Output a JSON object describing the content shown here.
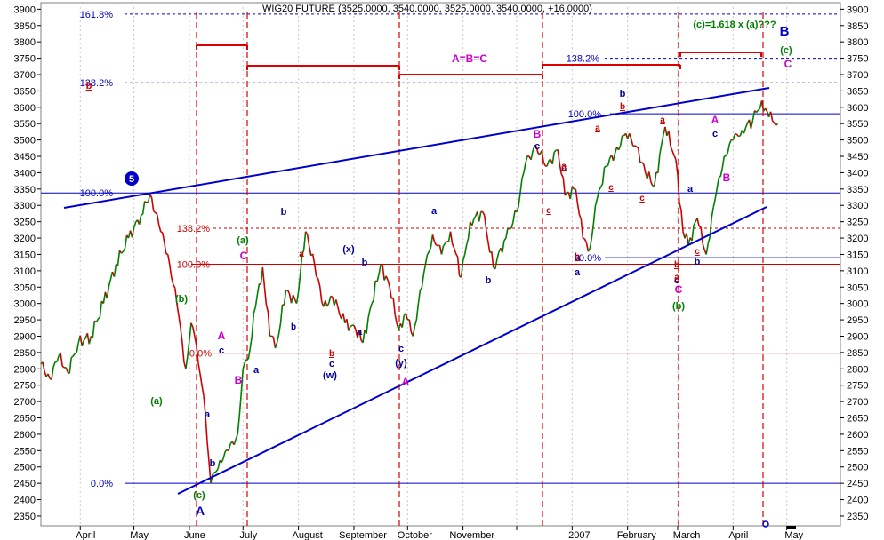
{
  "chart_data": {
    "type": "line",
    "title": "WIG20 FUTURE (3525.0000, 3540.0000, 3525.0000, 3540.0000, +16.0000)",
    "ylim": [
      2320,
      3920
    ],
    "y_ticks": [
      2350,
      2400,
      2450,
      2500,
      2550,
      2600,
      2650,
      2700,
      2750,
      2800,
      2850,
      2900,
      2950,
      3000,
      3050,
      3100,
      3150,
      3200,
      3250,
      3300,
      3350,
      3400,
      3450,
      3500,
      3550,
      3600,
      3650,
      3700,
      3750,
      3800,
      3850,
      3900
    ],
    "x_range": [
      "2006-03-10",
      "2007-05-31"
    ],
    "month_labels": [
      {
        "date": "2006-04-04",
        "label": "April"
      },
      {
        "date": "2006-05-04",
        "label": "May"
      },
      {
        "date": "2006-06-04",
        "label": "June"
      },
      {
        "date": "2006-07-04",
        "label": "July"
      },
      {
        "date": "2006-08-06",
        "label": "August"
      },
      {
        "date": "2006-09-06",
        "label": "September"
      },
      {
        "date": "2006-10-05",
        "label": "October"
      },
      {
        "date": "2006-11-06",
        "label": "November"
      },
      {
        "date": "2007-01-05",
        "label": "2007"
      },
      {
        "date": "2007-02-06",
        "label": "February"
      },
      {
        "date": "2007-03-06",
        "label": "March"
      },
      {
        "date": "2007-04-04",
        "label": "April"
      },
      {
        "date": "2007-05-05",
        "label": "May"
      }
    ],
    "grid_dates": [
      "2006-04-01",
      "2006-05-01",
      "2006-06-01",
      "2006-07-01",
      "2006-08-01",
      "2006-09-01",
      "2006-10-01",
      "2006-11-01",
      "2006-12-01",
      "2007-01-01",
      "2007-02-01",
      "2007-03-01",
      "2007-04-01",
      "2007-05-01"
    ],
    "series": [
      {
        "values": [
          [
            "2006-03-10",
            2815
          ],
          [
            "2006-03-15",
            2770
          ],
          [
            "2006-03-20",
            2840
          ],
          [
            "2006-03-25",
            2790
          ],
          [
            "2006-03-31",
            2880
          ],
          [
            "2006-04-07",
            2900
          ],
          [
            "2006-04-14",
            3000
          ],
          [
            "2006-04-21",
            3120
          ],
          [
            "2006-04-28",
            3200
          ],
          [
            "2006-05-05",
            3270
          ],
          [
            "2006-05-10",
            3335
          ],
          [
            "2006-05-15",
            3240
          ],
          [
            "2006-05-20",
            3150
          ],
          [
            "2006-05-25",
            3000
          ],
          [
            "2006-05-30",
            2800
          ],
          [
            "2006-06-02",
            2940
          ],
          [
            "2006-06-05",
            2870
          ],
          [
            "2006-06-08",
            2750
          ],
          [
            "2006-06-10",
            2660
          ],
          [
            "2006-06-13",
            2450
          ],
          [
            "2006-06-18",
            2520
          ],
          [
            "2006-06-23",
            2550
          ],
          [
            "2006-06-28",
            2600
          ],
          [
            "2006-07-01",
            2800
          ],
          [
            "2006-07-04",
            2830
          ],
          [
            "2006-07-08",
            2990
          ],
          [
            "2006-07-12",
            3110
          ],
          [
            "2006-07-16",
            2900
          ],
          [
            "2006-07-20",
            2880
          ],
          [
            "2006-07-25",
            3040
          ],
          [
            "2006-07-31",
            3000
          ],
          [
            "2006-08-05",
            3220
          ],
          [
            "2006-08-10",
            3120
          ],
          [
            "2006-08-15",
            2990
          ],
          [
            "2006-08-20",
            3020
          ],
          [
            "2006-08-27",
            2940
          ],
          [
            "2006-09-02",
            2920
          ],
          [
            "2006-09-06",
            2880
          ],
          [
            "2006-09-11",
            3000
          ],
          [
            "2006-09-16",
            3120
          ],
          [
            "2006-09-21",
            3050
          ],
          [
            "2006-09-26",
            2920
          ],
          [
            "2006-09-30",
            2970
          ],
          [
            "2006-10-04",
            2900
          ],
          [
            "2006-10-10",
            3090
          ],
          [
            "2006-10-15",
            3210
          ],
          [
            "2006-10-20",
            3150
          ],
          [
            "2006-10-25",
            3220
          ],
          [
            "2006-10-31",
            3080
          ],
          [
            "2006-11-05",
            3250
          ],
          [
            "2006-11-12",
            3280
          ],
          [
            "2006-11-18",
            3110
          ],
          [
            "2006-11-25",
            3200
          ],
          [
            "2006-12-01",
            3280
          ],
          [
            "2006-12-06",
            3430
          ],
          [
            "2006-12-12",
            3480
          ],
          [
            "2006-12-18",
            3420
          ],
          [
            "2006-12-24",
            3470
          ],
          [
            "2006-12-28",
            3330
          ],
          [
            "2007-01-03",
            3350
          ],
          [
            "2007-01-07",
            3200
          ],
          [
            "2007-01-11",
            3170
          ],
          [
            "2007-01-15",
            3320
          ],
          [
            "2007-01-20",
            3420
          ],
          [
            "2007-01-25",
            3460
          ],
          [
            "2007-01-31",
            3520
          ],
          [
            "2007-02-06",
            3480
          ],
          [
            "2007-02-11",
            3400
          ],
          [
            "2007-02-16",
            3360
          ],
          [
            "2007-02-22",
            3540
          ],
          [
            "2007-02-28",
            3440
          ],
          [
            "2007-03-04",
            3220
          ],
          [
            "2007-03-07",
            3180
          ],
          [
            "2007-03-12",
            3260
          ],
          [
            "2007-03-17",
            3150
          ],
          [
            "2007-03-22",
            3320
          ],
          [
            "2007-03-27",
            3450
          ],
          [
            "2007-04-01",
            3500
          ],
          [
            "2007-04-06",
            3530
          ],
          [
            "2007-04-12",
            3560
          ],
          [
            "2007-04-17",
            3620
          ],
          [
            "2007-04-21",
            3570
          ],
          [
            "2007-04-26",
            3550
          ]
        ]
      }
    ]
  },
  "h_lines": [
    {
      "value": 3885,
      "label": "161.8%",
      "color": "#0000cc"
    },
    {
      "value": 3675,
      "label": "138.2%",
      "color": "#0000cc"
    },
    {
      "value": 3338,
      "label": "100.0%",
      "color": "#0000cc"
    },
    {
      "value": 2450,
      "label": "0.0%",
      "color": "#0000cc"
    },
    {
      "value": 3230,
      "label": "138.2%",
      "color": "#cc0000"
    },
    {
      "value": 3120,
      "label": "100.0%",
      "color": "#cc0000"
    },
    {
      "value": 2848,
      "label": "0.0%",
      "color": "#cc0000"
    },
    {
      "value": 3750,
      "label": "138.2%",
      "color": "#0000cc"
    },
    {
      "value": 3580,
      "label": "100.0%",
      "color": "#0000cc"
    },
    {
      "value": 3140,
      "label": "0.0%",
      "color": "#0000cc"
    }
  ],
  "wave_labels": [
    {
      "text": "5",
      "color": "#0000cc"
    },
    {
      "text": "A",
      "color": "#0000cc"
    },
    {
      "text": "B",
      "color": "#0000cc"
    },
    {
      "text": "(a)",
      "color": "#008000"
    },
    {
      "text": "(b)",
      "color": "#008000"
    },
    {
      "text": "(c)",
      "color": "#008000"
    },
    {
      "text": "(a)",
      "color": "#008000"
    },
    {
      "text": "(b)",
      "color": "#008000"
    },
    {
      "text": "(c)",
      "color": "#008000"
    },
    {
      "text": "(c)=1.618 x (a)???",
      "color": "#008000"
    },
    {
      "text": "A=B=C",
      "color": "#cc00cc"
    },
    {
      "text": "A",
      "color": "#cc00cc"
    },
    {
      "text": "B",
      "color": "#cc00cc"
    },
    {
      "text": "C",
      "color": "#cc00cc"
    },
    {
      "text": "A",
      "color": "#cc00cc"
    },
    {
      "text": "B",
      "color": "#cc00cc"
    },
    {
      "text": "C",
      "color": "#cc00cc"
    },
    {
      "text": "A",
      "color": "#cc00cc"
    },
    {
      "text": "B",
      "color": "#cc00cc"
    },
    {
      "text": "C",
      "color": "#cc00cc"
    },
    {
      "text": "a",
      "color": "#000099"
    },
    {
      "text": "b",
      "color": "#000099"
    },
    {
      "text": "c",
      "color": "#000099"
    },
    {
      "text": "a",
      "color": "#000099"
    },
    {
      "text": "b",
      "color": "#000099"
    },
    {
      "text": "(x)",
      "color": "#000099"
    },
    {
      "text": "b",
      "color": "#000099"
    },
    {
      "text": "c",
      "color": "#000099"
    },
    {
      "text": "(w)",
      "color": "#000099"
    },
    {
      "text": "a",
      "color": "#000099"
    },
    {
      "text": "(y)",
      "color": "#000099"
    },
    {
      "text": "c",
      "color": "#000099"
    },
    {
      "text": "a",
      "color": "#000099"
    },
    {
      "text": "b",
      "color": "#000099"
    },
    {
      "text": "c",
      "color": "#000099"
    },
    {
      "text": "a",
      "color": "#000099"
    },
    {
      "text": "b",
      "color": "#000099"
    },
    {
      "text": "c",
      "color": "#000099"
    },
    {
      "text": "a",
      "color": "#000099"
    },
    {
      "text": "b",
      "color": "#000099"
    },
    {
      "text": "c",
      "color": "#000099"
    },
    {
      "text": "a",
      "color": "#000099"
    },
    {
      "text": "c",
      "color": "#000099"
    },
    {
      "text": "b",
      "color": "#000099"
    },
    {
      "text": "a",
      "color": "#cc0000"
    },
    {
      "text": "b",
      "color": "#cc0000"
    },
    {
      "text": "c",
      "color": "#cc0000"
    },
    {
      "text": "a",
      "color": "#cc0000"
    },
    {
      "text": "b",
      "color": "#cc0000"
    },
    {
      "text": "c",
      "color": "#cc0000"
    },
    {
      "text": "a",
      "color": "#cc0000"
    },
    {
      "text": "b",
      "color": "#cc0000"
    },
    {
      "text": "c",
      "color": "#cc0000"
    },
    {
      "text": "a",
      "color": "#cc0000"
    },
    {
      "text": "b",
      "color": "#cc0000"
    },
    {
      "text": "c",
      "color": "#cc0000"
    },
    {
      "text": "a",
      "color": "#cc0000"
    },
    {
      "text": "b",
      "color": "#cc0000"
    }
  ],
  "colors": {
    "price": "#008000",
    "price_down": "#cc0000",
    "trend": "#0000cc",
    "red_marks": "#dd0000",
    "text": "#000000"
  }
}
